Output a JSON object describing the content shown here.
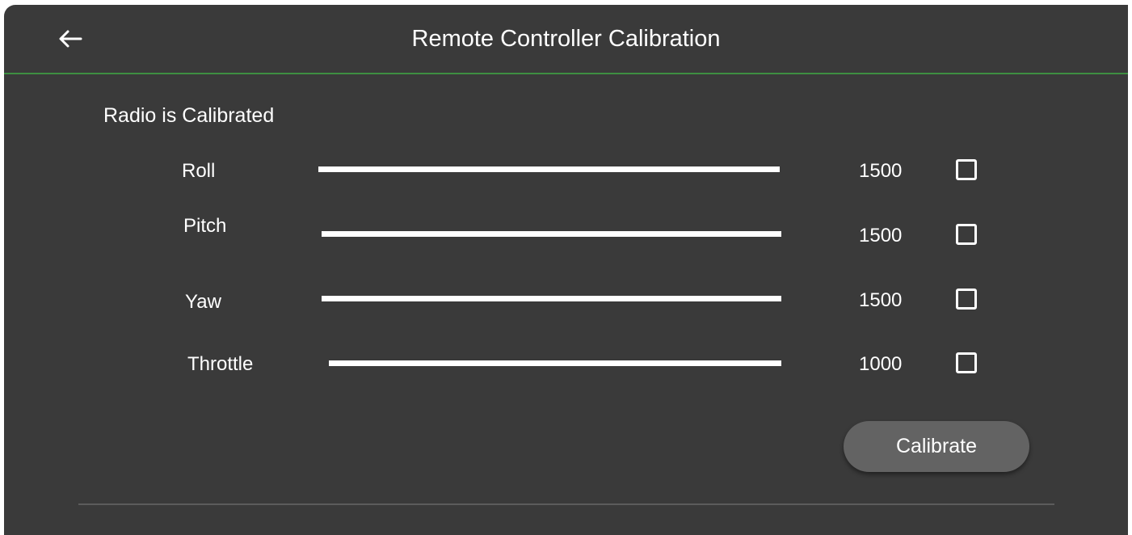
{
  "header": {
    "title": "Remote Controller Calibration",
    "back_icon": "arrow-left-icon"
  },
  "status_text": "Radio is Calibrated",
  "channels": [
    {
      "label": "Roll",
      "value": "1500",
      "checked": false
    },
    {
      "label": "Pitch",
      "value": "1500",
      "checked": false
    },
    {
      "label": "Yaw",
      "value": "1500",
      "checked": false
    },
    {
      "label": "Throttle",
      "value": "1000",
      "checked": false
    }
  ],
  "calibrate_label": "Calibrate",
  "colors": {
    "background": "#3a3a3a",
    "header_divider": "#3e8e41",
    "button_bg": "#636363",
    "text": "#ffffff"
  }
}
